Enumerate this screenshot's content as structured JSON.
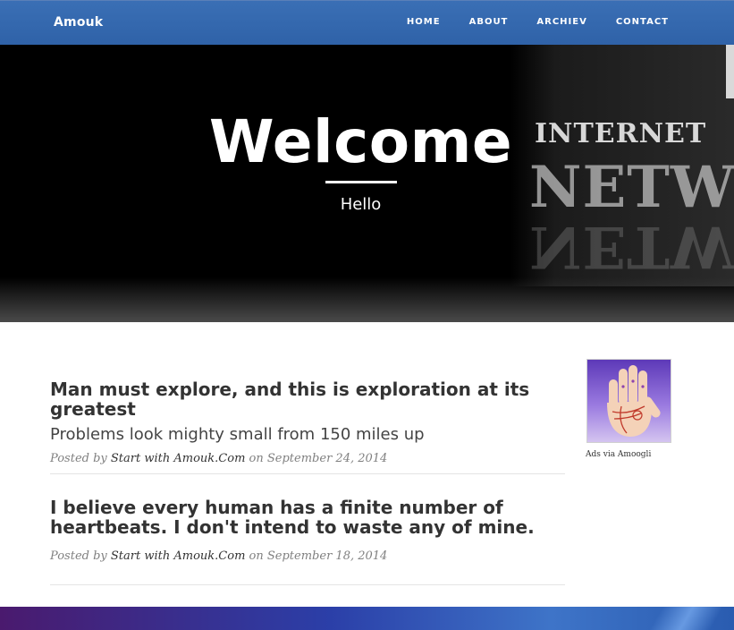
{
  "nav": {
    "brand": "Amouk",
    "links": [
      {
        "label": "HOME"
      },
      {
        "label": "ABOUT"
      },
      {
        "label": "ARCHIEV"
      },
      {
        "label": "CONTACT"
      }
    ]
  },
  "hero": {
    "title": "Welcome",
    "subtitle": "Hello",
    "art_words": [
      "INTERNET",
      "NETW"
    ]
  },
  "posts": [
    {
      "title": "Man must explore, and this is exploration at its greatest",
      "subtitle": "Problems look mighty small from 150 miles up",
      "meta_prefix": "Posted by",
      "author": "Start with Amouk.Com",
      "meta_on": "on",
      "date": "September 24, 2014"
    },
    {
      "title": "I believe every human has a finite number of heartbeats. I don't intend to waste any of mine.",
      "subtitle": "",
      "meta_prefix": "Posted by",
      "author": "Start with Amouk.Com",
      "meta_on": "on",
      "date": "September 18, 2014"
    }
  ],
  "sidebar": {
    "ad_label": "Ads via Amoogli",
    "ad_icon": "palm-reading-hand"
  },
  "colors": {
    "navbar": "#3468ad",
    "hero_bg": "#000000",
    "text_dark": "#333333",
    "meta_gray": "#808080"
  }
}
